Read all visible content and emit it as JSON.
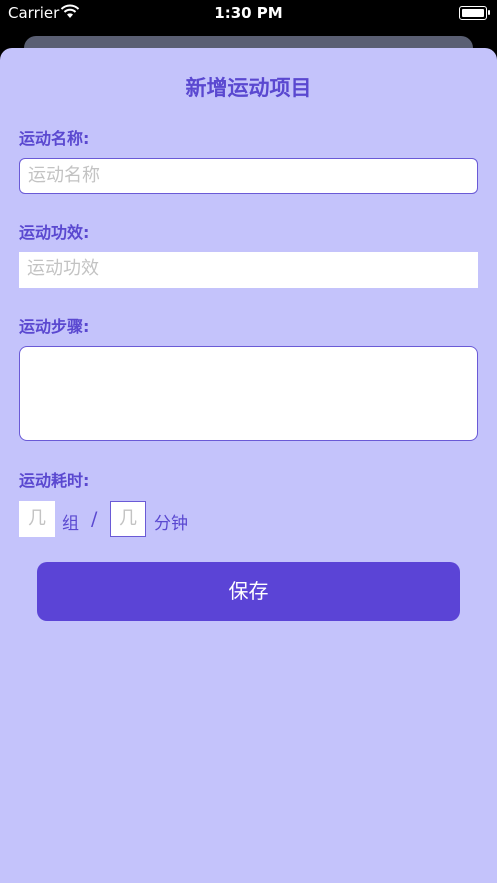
{
  "status_bar": {
    "carrier": "Carrier",
    "time": "1:30 PM"
  },
  "form": {
    "title": "新增运动项目",
    "name_label": "运动名称:",
    "name_placeholder": "运动名称",
    "effect_label": "运动功效:",
    "effect_placeholder": "运动功效",
    "steps_label": "运动步骤:",
    "duration_label": "运动耗时:",
    "sets_placeholder": "几",
    "sets_unit": "组",
    "separator": "/",
    "minutes_placeholder": "几",
    "minutes_unit": "分钟",
    "save_label": "保存"
  },
  "colors": {
    "sheet_bg": "#c4c3fb",
    "accent": "#5a48d0",
    "button": "#5b44d6"
  }
}
